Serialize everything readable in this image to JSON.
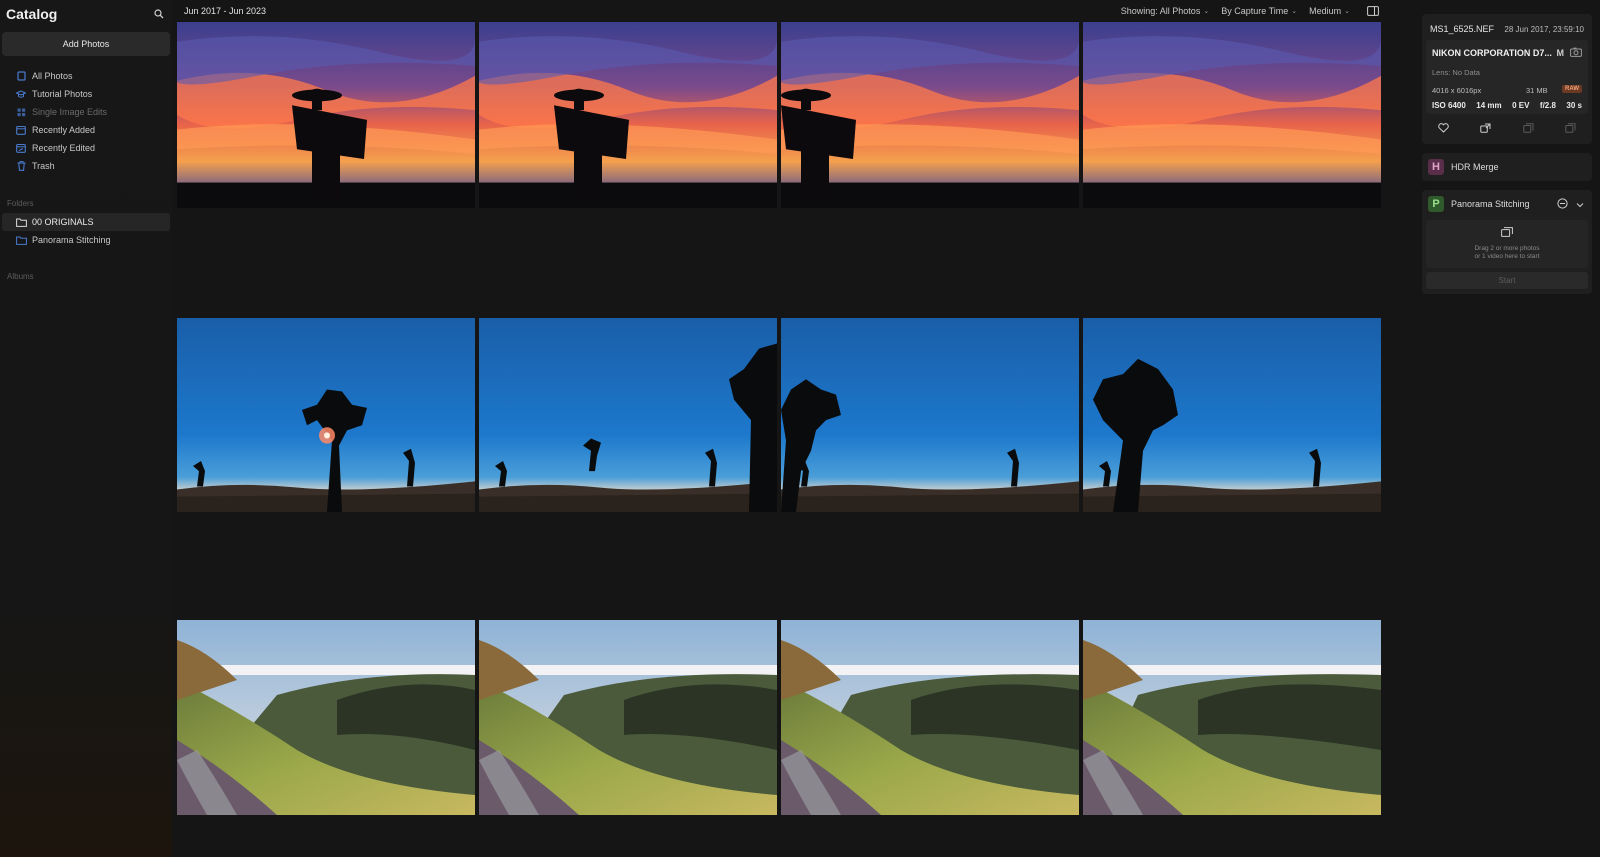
{
  "sidebar": {
    "title": "Catalog",
    "add_photos_label": "Add Photos",
    "nav_items": [
      {
        "label": "All Photos",
        "icon": "photos-icon"
      },
      {
        "label": "Tutorial Photos",
        "icon": "graduation-cap-icon"
      },
      {
        "label": "Single Image Edits",
        "icon": "grid-icon",
        "dim": true
      },
      {
        "label": "Recently Added",
        "icon": "calendar-add-icon"
      },
      {
        "label": "Recently Edited",
        "icon": "calendar-edit-icon"
      },
      {
        "label": "Trash",
        "icon": "trash-icon"
      }
    ],
    "folders_label": "Folders",
    "folders": [
      {
        "label": "00 ORIGINALS",
        "active": true
      },
      {
        "label": "Panorama Stitching",
        "active": false
      }
    ],
    "albums_label": "Albums"
  },
  "topbar": {
    "date_range": "Jun 2017 - Jun 2023",
    "showing": "Showing: All Photos",
    "sort": "By Capture Time",
    "size": "Medium"
  },
  "thumbnails": [
    {
      "scene": "sunset-sign",
      "variant": 0
    },
    {
      "scene": "sunset-sign",
      "variant": 1
    },
    {
      "scene": "sunset-sign",
      "variant": 2
    },
    {
      "scene": "sunset-sign",
      "variant": 3
    },
    {
      "scene": "joshua-night",
      "variant": 0
    },
    {
      "scene": "joshua-night",
      "variant": 1
    },
    {
      "scene": "joshua-night",
      "variant": 2
    },
    {
      "scene": "joshua-night",
      "variant": 3
    },
    {
      "scene": "mountain-ridge",
      "variant": 0
    },
    {
      "scene": "mountain-ridge",
      "variant": 1
    },
    {
      "scene": "mountain-ridge",
      "variant": 2
    },
    {
      "scene": "mountain-ridge",
      "variant": 3
    }
  ],
  "info": {
    "filename": "MS1_6525.NEF",
    "date": "28 Jun 2017, 23:59:10",
    "camera": "NIKON CORPORATION D7...",
    "mode": "M",
    "lens": "Lens: No Data",
    "dimensions": "4016 x 6016px",
    "file_size": "31 MB",
    "format_badge": "RAW",
    "iso": "ISO 6400",
    "focal": "14 mm",
    "ev": "0 EV",
    "aperture": "f/2.8",
    "shutter": "30 s"
  },
  "tools": {
    "hdr": {
      "badge": "H",
      "label": "HDR Merge"
    },
    "panorama": {
      "badge": "P",
      "label": "Panorama Stitching",
      "drop_line1": "Drag 2 or more photos",
      "drop_line2": "or 1 video here to start",
      "start_label": "Start"
    }
  },
  "colors": {
    "accent_blue": "#4a7bd0",
    "raw_badge": "#6b3a23"
  }
}
